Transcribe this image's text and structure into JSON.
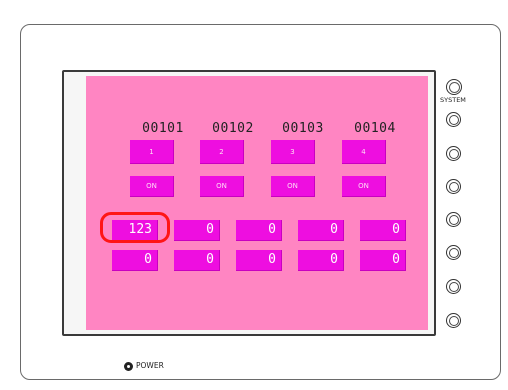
{
  "panel": {
    "side_label": "SYSTEM",
    "power_label": "POWER",
    "function_key_count": 7
  },
  "screen": {
    "background_color": "#ff85c2",
    "accent_color": "#ee0ee0",
    "highlight_color": "#ff1515",
    "headers": [
      "00101",
      "00102",
      "00103",
      "00104"
    ],
    "row1_buttons": [
      "1",
      "2",
      "3",
      "4"
    ],
    "row2_buttons": [
      "ON",
      "ON",
      "ON",
      "ON"
    ],
    "numeric_row1": [
      "123",
      "0",
      "0",
      "0",
      "0"
    ],
    "numeric_row2": [
      "0",
      "0",
      "0",
      "0",
      "0"
    ]
  }
}
